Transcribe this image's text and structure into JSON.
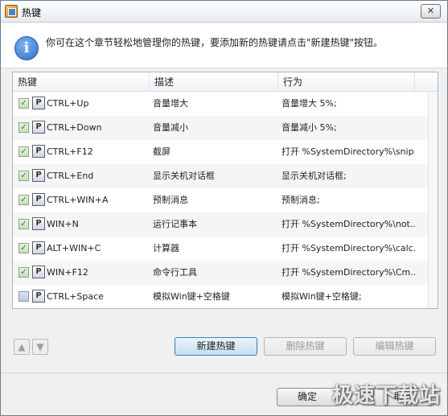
{
  "window": {
    "title": "热键",
    "close_label": "✕"
  },
  "info": {
    "text": "你可在这个章节轻松地管理你的热键，要添加新的热键请点击\"新建热键\"按钮。",
    "icon": "info-icon"
  },
  "table": {
    "columns": [
      "热键",
      "描述",
      "行为"
    ],
    "rows": [
      {
        "checked": true,
        "hotkey": "CTRL+Up",
        "desc": "音量增大",
        "action": "音量增大 5%;"
      },
      {
        "checked": true,
        "hotkey": "CTRL+Down",
        "desc": "音量减小",
        "action": "音量减小 5%;"
      },
      {
        "checked": true,
        "hotkey": "CTRL+F12",
        "desc": "截屏",
        "action": "打开 %SystemDirectory%\\snip..."
      },
      {
        "checked": true,
        "hotkey": "CTRL+End",
        "desc": "显示关机对话框",
        "action": "显示关机对话框;"
      },
      {
        "checked": true,
        "hotkey": "CTRL+WIN+A",
        "desc": "预制消息",
        "action": "预制消息;"
      },
      {
        "checked": true,
        "hotkey": "WIN+N",
        "desc": "运行记事本",
        "action": "打开 %SystemDirectory%\\not..."
      },
      {
        "checked": true,
        "hotkey": "ALT+WIN+C",
        "desc": "计算器",
        "action": "打开 %SystemDirectory%\\calc..."
      },
      {
        "checked": true,
        "hotkey": "WIN+F12",
        "desc": "命令行工具",
        "action": "打开 %SystemDirectory%\\Cm..."
      },
      {
        "checked": false,
        "hotkey": "CTRL+Space",
        "desc": "模拟Win键+空格键",
        "action": "模拟Win键+空格键;"
      }
    ]
  },
  "toolbar": {
    "move_up": "▲",
    "move_down": "▼",
    "new_label": "新建热键",
    "delete_label": "删除热键",
    "edit_label": "编辑热键"
  },
  "footer": {
    "ok_label": "确定",
    "cancel_label": "取消"
  },
  "watermark": "极速下载站",
  "colors": {
    "accent": "#3c7fb1",
    "check": "#3a7a2a"
  }
}
